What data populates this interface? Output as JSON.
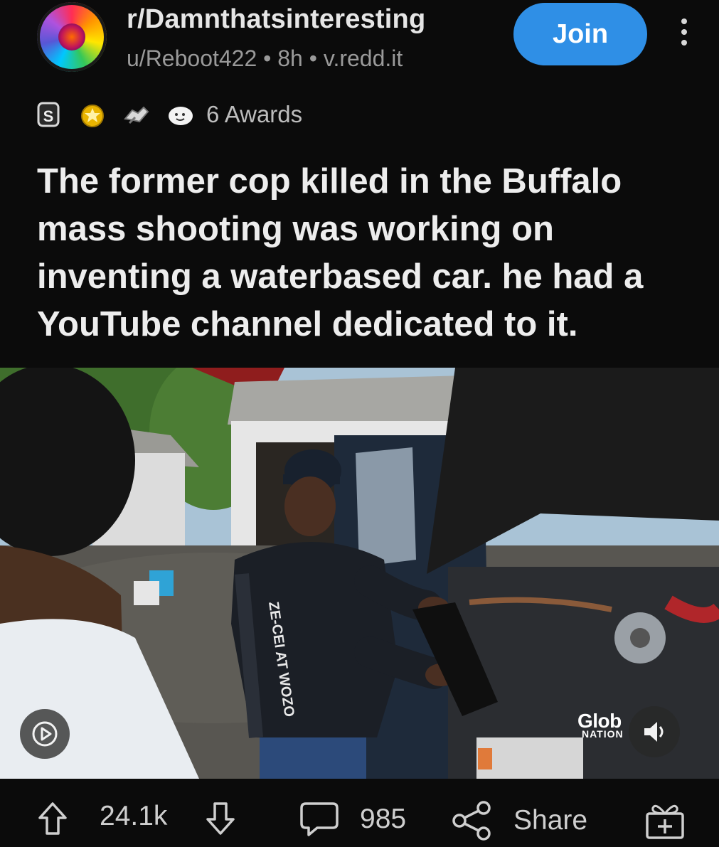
{
  "header": {
    "subreddit": "r/Damnthatsinteresting",
    "meta": "u/Reboot422 • 8h • v.redd.it",
    "join_label": "Join"
  },
  "awards": {
    "icons": [
      "silver-award-icon",
      "gold-award-icon",
      "handshake-award-icon",
      "wholesome-award-icon"
    ],
    "label": "6 Awards"
  },
  "post": {
    "title": "The former cop killed in the Buffalo mass shooting was working on inventing a waterbased car. he had a YouTube channel dedicated to it."
  },
  "media": {
    "watermark_main": "Glob",
    "watermark_sub": "NATION",
    "shirt_text": "ZE-CEI AT WOZO"
  },
  "actions": {
    "upvotes": "24.1k",
    "comments": "985",
    "share_label": "Share"
  },
  "colors": {
    "background": "#0b0b0b",
    "join_button": "#2f8fe6",
    "text_primary": "#ededed",
    "text_meta": "#9a9a9a"
  }
}
